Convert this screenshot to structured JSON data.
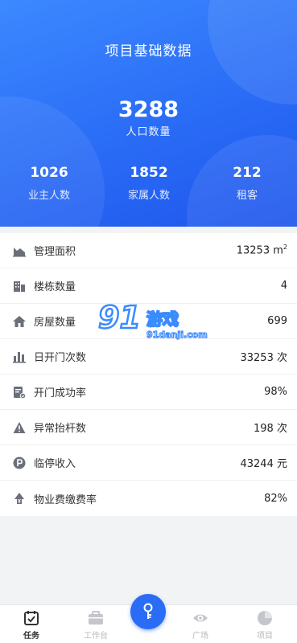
{
  "header": {
    "title": "项目基础数据",
    "total_value": "3288",
    "total_label": "人口数量",
    "stats": [
      {
        "value": "1026",
        "label": "业主人数"
      },
      {
        "value": "1852",
        "label": "家属人数"
      },
      {
        "value": "212",
        "label": "租客"
      }
    ]
  },
  "list": {
    "rows": [
      {
        "label": "管理面积",
        "value": "13253",
        "unit": "m",
        "unit_sup": "2",
        "icon": "area-chart-icon"
      },
      {
        "label": "楼栋数量",
        "value": "4",
        "icon": "building-icon"
      },
      {
        "label": "房屋数量",
        "value": "699",
        "icon": "house-icon"
      },
      {
        "label": "日开门次数",
        "value": "33253",
        "unit": "次",
        "icon": "bar-chart-icon"
      },
      {
        "label": "开门成功率",
        "value": "98%",
        "icon": "document-check-icon"
      },
      {
        "label": "异常抬杆数",
        "value": "198",
        "unit": "次",
        "icon": "warning-icon"
      },
      {
        "label": "临停收入",
        "value": "43244",
        "unit": "元",
        "icon": "parking-icon"
      },
      {
        "label": "物业费缴费率",
        "value": "82%",
        "icon": "fee-icon"
      }
    ]
  },
  "watermark": {
    "text": "91游戏",
    "sub": "91danji.com"
  },
  "tabbar": {
    "tabs": [
      {
        "label": "任务",
        "active": true
      },
      {
        "label": "工作台",
        "active": false
      },
      {
        "label": "广场",
        "active": false
      },
      {
        "label": "项目",
        "active": false
      }
    ]
  },
  "colors": {
    "accent": "#2a6cf6",
    "icon": "#6b6f7a"
  }
}
